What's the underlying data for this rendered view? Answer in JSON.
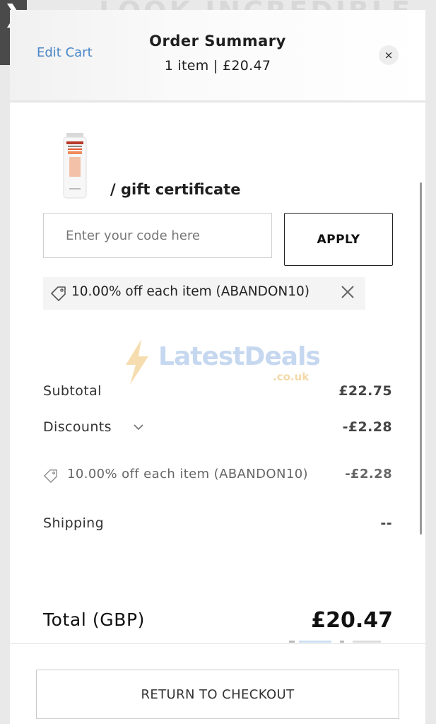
{
  "background": {
    "brand_text": "LOOK INCREDIBLE"
  },
  "side_tab": {
    "glyph": "❯"
  },
  "header": {
    "edit_cart": "Edit Cart",
    "title": "Order Summary",
    "subtitle": "1 item | £20.47",
    "close_glyph": "×"
  },
  "promo": {
    "label": "/ gift certificate",
    "input_placeholder": "Enter your code here",
    "input_value": "",
    "apply_label": "APPLY",
    "applied_discount": "10.00% off each item (ABANDON10)"
  },
  "watermark": {
    "brand": "LatestDeals",
    "suffix": ".co.uk"
  },
  "summary": {
    "subtotal_label": "Subtotal",
    "subtotal_value": "£22.75",
    "discounts_label": "Discounts",
    "discounts_value": "-£2.28",
    "discount_line_label": "10.00% off each item (ABANDON10)",
    "discount_line_value": "-£2.28",
    "shipping_label": "Shipping",
    "shipping_value": "--",
    "total_label": "Total (GBP)",
    "total_value": "£20.47"
  },
  "footer": {
    "return_label": "RETURN TO CHECKOUT"
  },
  "colors": {
    "link": "#4a86c8",
    "watermark_blue": "#c6d8f0",
    "watermark_orange": "#f3d9a8"
  },
  "icons": [
    "chevron-right-icon",
    "close-icon",
    "tag-icon",
    "chevron-down-icon",
    "lightning-icon",
    "product-thumbnail"
  ]
}
